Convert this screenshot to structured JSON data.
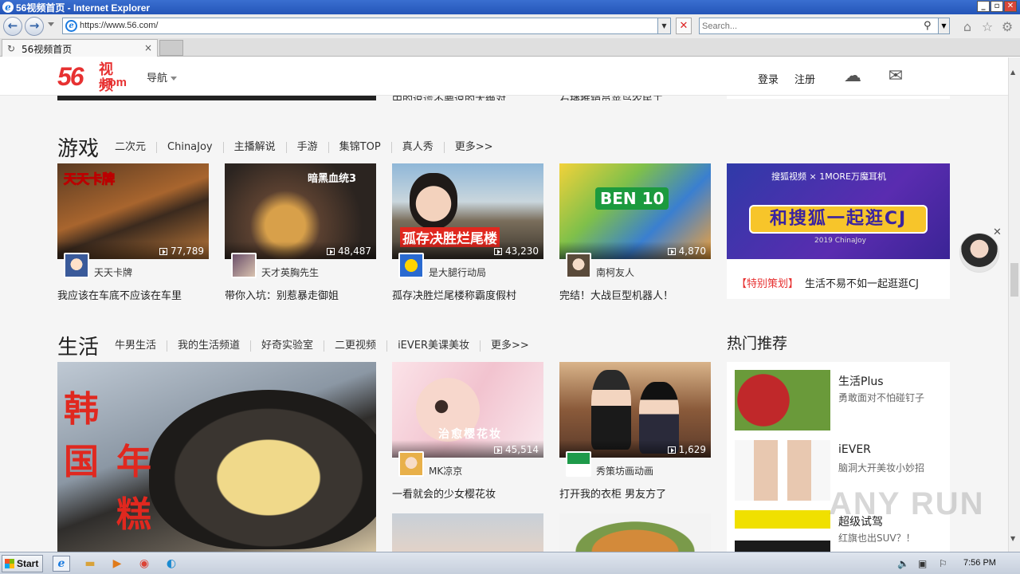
{
  "window": {
    "title": "56视频首页 - Internet Explorer",
    "controls": [
      "_",
      "▫",
      "✕"
    ]
  },
  "browser": {
    "url": "https://www.56.com/",
    "search_placeholder": "Search...",
    "tab_title": "56视频首页",
    "tab_close": "×"
  },
  "site": {
    "logo_num": "56",
    "logo_zh": "视频",
    "logo_com": ".com",
    "nav_guide": "导航",
    "login": "登录",
    "register": "注册"
  },
  "prev_section": {
    "text_left": "中的说谎不要说的太绝对",
    "text_right": "石播推销员苹鸟农民工"
  },
  "games": {
    "title": "游戏",
    "subnav": [
      "二次元",
      "ChinaJoy",
      "主播解说",
      "手游",
      "集锦TOP",
      "真人秀",
      "更多>>"
    ],
    "cards": [
      {
        "author": "天天卡牌",
        "plays": "77,789",
        "title": "我应该在车底不应该在车里",
        "thumb_text": "天天卡牌"
      },
      {
        "author": "天才英胸先生",
        "plays": "48,487",
        "title": "带你入坑：别惹暴走御姐",
        "thumb_text": "暗黑血统3"
      },
      {
        "author": "是大腿行动局",
        "plays": "43,230",
        "title": "孤存决胜烂尾楼称霸度假村",
        "thumb_text": "孤存决胜烂尾楼"
      },
      {
        "author": "南柯友人",
        "plays": "4,870",
        "title": "完结！大战巨型机器人！",
        "thumb_text": "BEN 10"
      }
    ],
    "promo": {
      "banner_top": "搜狐视频 × 1MORE万魔耳机",
      "banner_main": "和搜狐一起逛CJ",
      "banner_sub": "2019 ChinaJoy",
      "tag": "【特别策划】",
      "text": "生活不易不如一起逛逛CJ"
    }
  },
  "life": {
    "title": "生活",
    "subnav": [
      "牛男生活",
      "我的生活频道",
      "好奇实验室",
      "二更视频",
      "iEVER美课美妆",
      "更多>>"
    ],
    "big_card_chars": [
      "韩",
      "国",
      "年",
      "糕"
    ],
    "cards": [
      {
        "author": "MK凉京",
        "plays": "45,514",
        "title": "一看就会的少女樱花妆",
        "thumb_text": "治愈樱花妆"
      },
      {
        "author": "秀策坊画动画",
        "plays": "1,629",
        "title": "打开我的衣柜 男友方了",
        "thumb_text": ""
      }
    ]
  },
  "hot": {
    "title": "热门推荐",
    "items": [
      {
        "name": "生活Plus",
        "desc": "勇敢面对不怕碰钉子"
      },
      {
        "name": "iEVER",
        "desc": "脑洞大开美妆小妙招"
      },
      {
        "name": "超级试驾",
        "desc": "红旗也出SUV？！"
      }
    ]
  },
  "watermark": "ANY RUN",
  "taskbar": {
    "start": "Start",
    "time": "7:56 PM"
  },
  "colors": {
    "brand_red": "#e73131",
    "ie_blue": "#2455b8",
    "page_bg": "#f5f5f5"
  }
}
